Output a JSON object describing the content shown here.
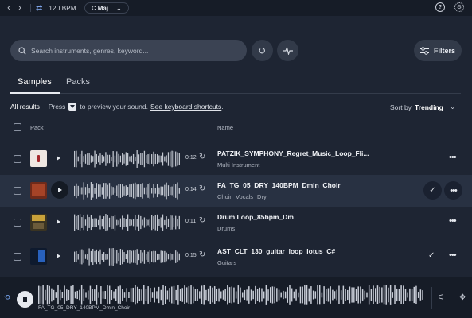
{
  "topbar": {
    "back_icon": "chevron-left-icon",
    "forward_icon": "chevron-right-icon",
    "bpm_icon": "sync-icon",
    "bpm_label": "120 BPM",
    "key_label": "C Maj",
    "help_icon": "help-icon",
    "settings_icon": "gear-icon"
  },
  "search": {
    "placeholder": "Search instruments, genres, keyword..."
  },
  "filters_label": "Filters",
  "tabs": [
    {
      "label": "Samples",
      "active": true
    },
    {
      "label": "Packs",
      "active": false
    }
  ],
  "info": {
    "all_results": "All results",
    "dot": "·",
    "press": "Press",
    "preview": "to preview your sound.",
    "shortcuts": "See keyboard shortcuts",
    "period": "."
  },
  "sort": {
    "label": "Sort by",
    "value": "Trending"
  },
  "columns": {
    "pack": "Pack",
    "name": "Name"
  },
  "rows": [
    {
      "name": "PATZIK_SYMPHONY_Regret_Music_Loop_Fli...",
      "tags": [
        "Multi Instrument"
      ],
      "duration": "0:12",
      "liked": false,
      "selected": false
    },
    {
      "name": "FA_TG_05_DRY_140BPM_Dmin_Choir",
      "tags": [
        "Choir",
        "Vocals",
        "Dry"
      ],
      "duration": "0:14",
      "liked": true,
      "selected": true
    },
    {
      "name": "Drum Loop_85bpm_Dm",
      "tags": [
        "Drums"
      ],
      "duration": "0:11",
      "liked": false,
      "selected": false
    },
    {
      "name": "AST_CLT_130_guitar_loop_lotus_C#",
      "tags": [
        "Guitars"
      ],
      "duration": "0:15",
      "liked": true,
      "selected": false
    }
  ],
  "player": {
    "now_playing": "FA_TG_05_DRY_140BPM_Dmin_Choir",
    "state": "playing"
  },
  "colors": {
    "background": "#1e2533",
    "accent": "#7fb0ff",
    "selected_row": "#283142"
  }
}
